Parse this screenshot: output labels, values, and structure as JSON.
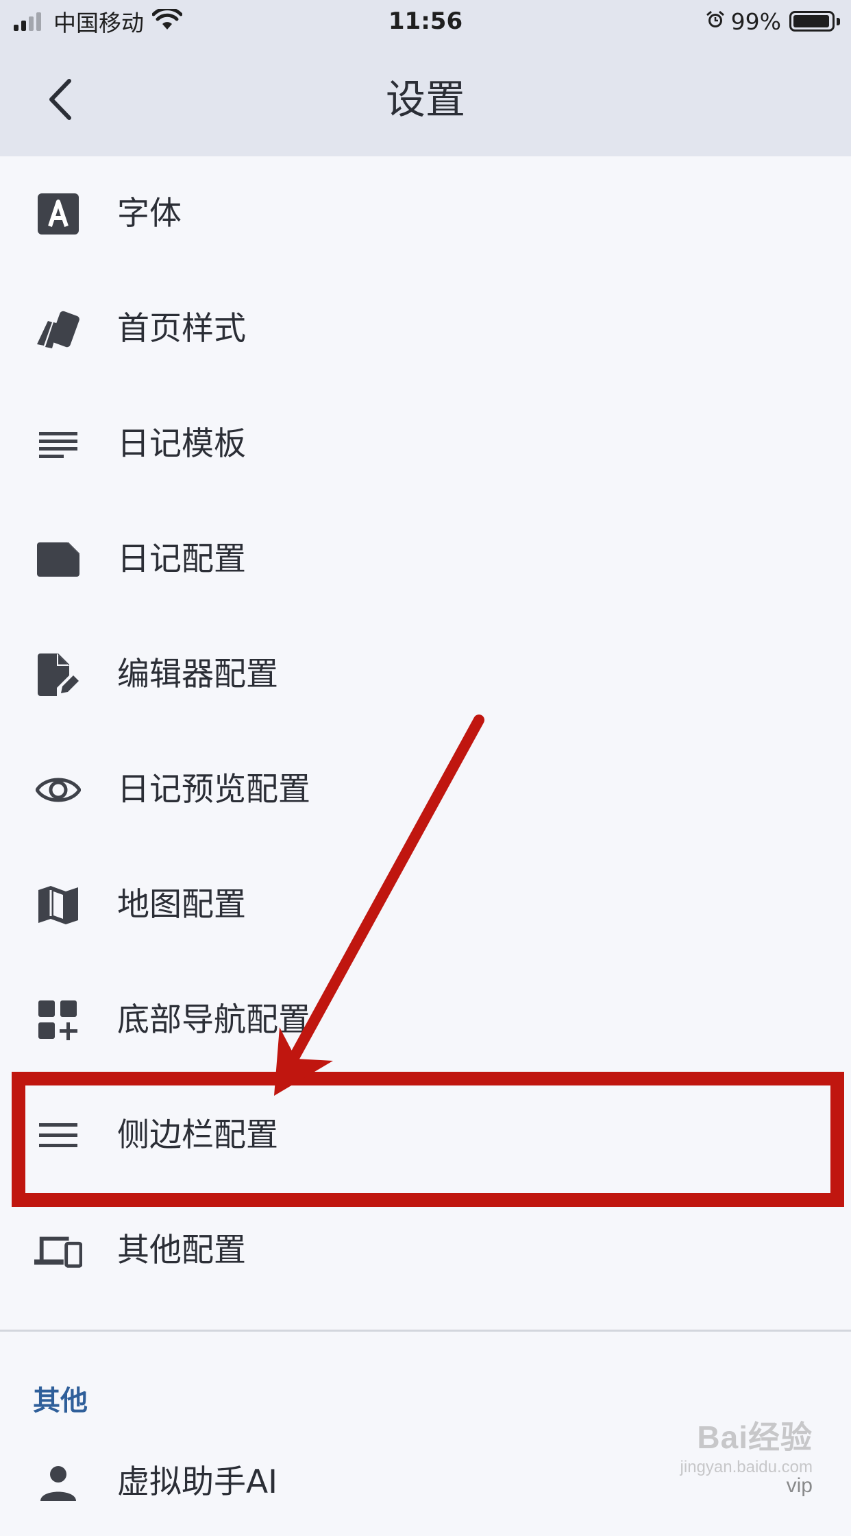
{
  "status_bar": {
    "carrier": "中国移动",
    "time": "11:56",
    "battery": "99%"
  },
  "nav": {
    "title": "设置"
  },
  "settings": [
    {
      "label": "字体",
      "icon": "font-icon"
    },
    {
      "label": "首页样式",
      "icon": "cards-icon"
    },
    {
      "label": "日记模板",
      "icon": "lines-icon"
    },
    {
      "label": "日记配置",
      "icon": "note-icon"
    },
    {
      "label": "编辑器配置",
      "icon": "edit-file-icon"
    },
    {
      "label": "日记预览配置",
      "icon": "eye-icon"
    },
    {
      "label": "地图配置",
      "icon": "map-icon"
    },
    {
      "label": "底部导航配置",
      "icon": "widgets-add-icon"
    },
    {
      "label": "侧边栏配置",
      "icon": "menu-icon"
    },
    {
      "label": "其他配置",
      "icon": "devices-icon"
    }
  ],
  "other_section": {
    "header": "其他",
    "items": [
      {
        "label": "虚拟助手AI",
        "icon": "person-icon"
      }
    ]
  },
  "annotation": {
    "color": "#c0160f",
    "highlighted_item": "侧边栏配置"
  },
  "watermark": {
    "main": "Bai经验",
    "sub": "jingyan.baidu.com",
    "vip": "vip"
  }
}
